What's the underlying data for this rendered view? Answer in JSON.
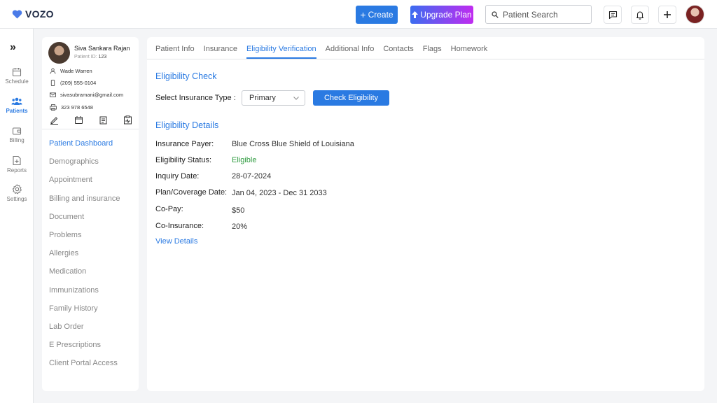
{
  "app": {
    "name": "VOZO"
  },
  "topbar": {
    "create_label": "Create",
    "upgrade_label": "Upgrade Plan",
    "search_placeholder": "Patient Search"
  },
  "leftnav": {
    "items": [
      {
        "label": "Schedule",
        "icon": "calendar-icon"
      },
      {
        "label": "Patients",
        "icon": "users-icon",
        "active": true
      },
      {
        "label": "Billing",
        "icon": "wallet-icon"
      },
      {
        "label": "Reports",
        "icon": "report-icon"
      },
      {
        "label": "Settings",
        "icon": "gear-icon"
      }
    ]
  },
  "patient": {
    "name": "Siva Sankara Rajan",
    "id_label": "Patient ID:",
    "id_value": "123",
    "contact_person": "Wade Warren",
    "phone": "(209) 555-0104",
    "email": "sivasubramani@gmail.com",
    "fax": "323 978 6548"
  },
  "patient_menu": [
    "Patient Dashboard",
    "Demographics",
    "Appointment",
    "Billing and insurance",
    "Document",
    "Problems",
    "Allergies",
    "Medication",
    "Immunizations",
    "Family History",
    "Lab Order",
    "E Prescriptions",
    "Client Portal Access"
  ],
  "tabs": [
    "Patient Info",
    "Insurance",
    "Eligibility Verification",
    "Additional Info",
    "Contacts",
    "Flags",
    "Homework"
  ],
  "active_tab": "Eligibility Verification",
  "eligibility_check": {
    "heading": "Eligibility Check",
    "select_label": "Select Insurance Type :",
    "select_value": "Primary",
    "button_label": "Check Eligibility"
  },
  "eligibility_details": {
    "heading": "Eligibility Details",
    "rows": [
      {
        "label": "Insurance Payer:",
        "value": "Blue Cross Blue Shield of Louisiana"
      },
      {
        "label": "Eligibility Status:",
        "value": "Eligible"
      },
      {
        "label": "Inquiry Date:",
        "value": "28-07-2024"
      },
      {
        "label": "Plan/Coverage Date:",
        "value": "Jan 04, 2023 - Dec 31 2033"
      },
      {
        "label": "Co-Pay:",
        "value": "$50"
      },
      {
        "label": "Co-Insurance:",
        "value": "20%"
      }
    ],
    "link_label": "View Details"
  },
  "colors": {
    "accent": "#2a7ae2",
    "eligible": "#2e9b3f",
    "upgrade_gradient_start": "#3b6cf0",
    "upgrade_gradient_end": "#c02cf0"
  }
}
